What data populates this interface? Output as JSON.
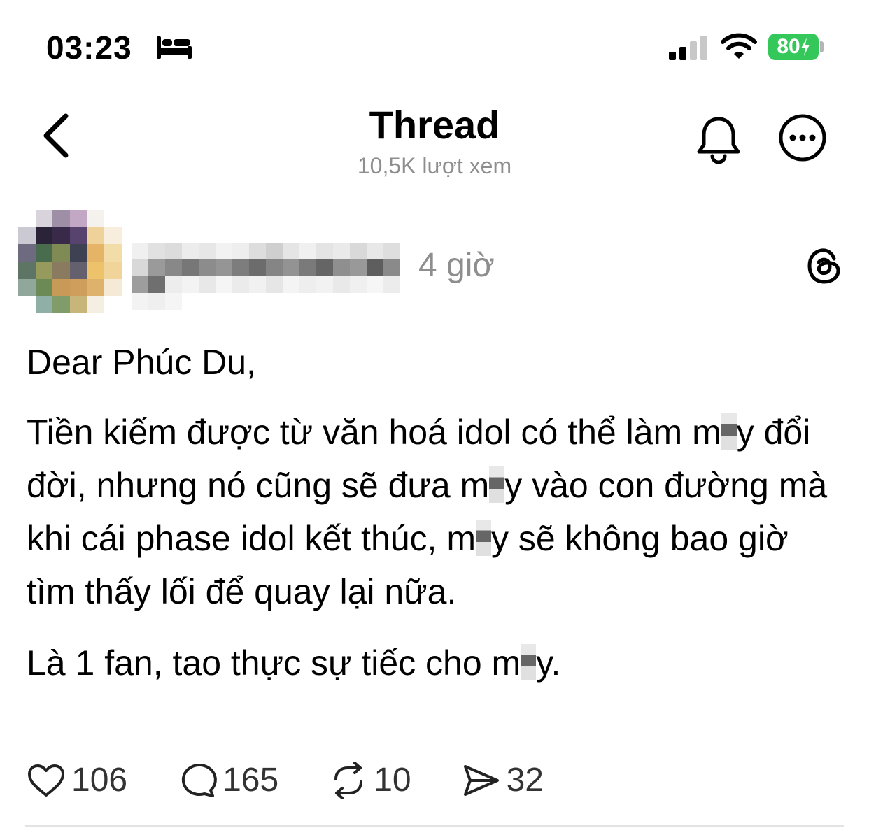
{
  "status_bar": {
    "time": "03:23",
    "battery_level": "80",
    "battery_color": "#34c759",
    "icons": [
      "bed-icon",
      "signal-icon",
      "wifi-icon",
      "battery-icon"
    ]
  },
  "header": {
    "title": "Thread",
    "subtitle": "10,5K lượt xem",
    "icons": [
      "back-icon",
      "bell-icon",
      "more-icon"
    ]
  },
  "post": {
    "time": "4 giờ",
    "greeting": "Dear Phúc Du,",
    "p2": {
      "a": "Tiền kiếm được từ văn hoá idol có thể làm m",
      "b": "y đổi đời, nhưng nó cũng sẽ đưa m",
      "c": "y vào con đường mà khi cái phase idol kết thúc, m",
      "d": "y sẽ không bao giờ tìm thấy lối để quay lại nữa."
    },
    "p3": {
      "a": "Là 1 fan, tao thực sự tiếc cho m",
      "b": "y."
    }
  },
  "actions": {
    "likes": "106",
    "comments": "165",
    "reposts": "10",
    "shares": "32"
  },
  "colors": {
    "muted_text": "#8e8e8e",
    "divider": "#e3e3e3"
  }
}
